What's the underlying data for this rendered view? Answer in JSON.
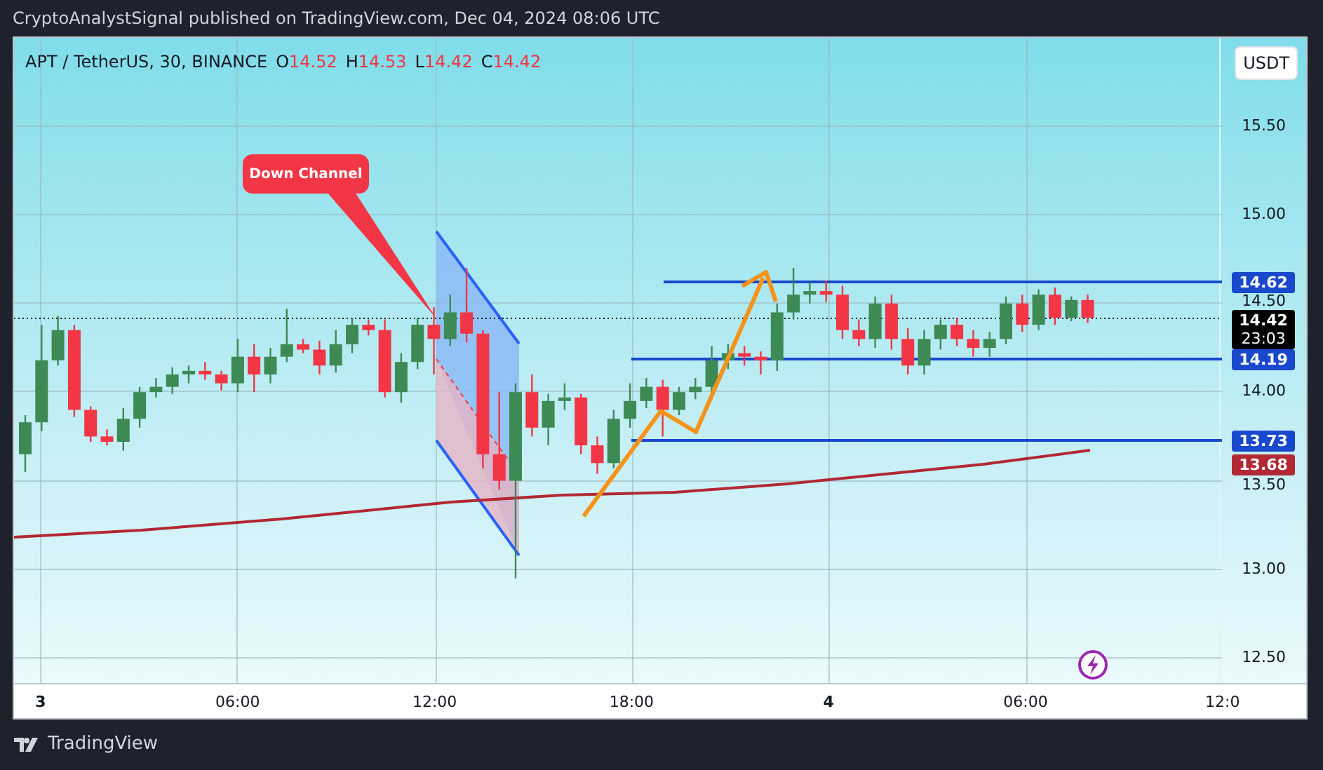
{
  "header": {
    "text": "CryptoAnalystSignal published on TradingView.com, Dec 04, 2024 08:06 UTC"
  },
  "legend": {
    "symbol": "APT / TetherUS, 30, BINANCE",
    "ohlc": [
      {
        "label": "O",
        "value": "14.52"
      },
      {
        "label": "H",
        "value": "14.53"
      },
      {
        "label": "L",
        "value": "14.42"
      },
      {
        "label": "C",
        "value": "14.42"
      }
    ]
  },
  "currency_button": "USDT",
  "annotation": {
    "text": "Down Channel"
  },
  "price_axis": {
    "labels": [
      "15.50",
      "15.00",
      "14.50",
      "14.00",
      "13.50",
      "13.00",
      "12.50"
    ]
  },
  "price_tags": [
    {
      "value": "14.62",
      "color": "#1848cc"
    },
    {
      "value": "14.42",
      "countdown": "23:03",
      "color": "#000000"
    },
    {
      "value": "14.19",
      "color": "#1848cc"
    },
    {
      "value": "13.73",
      "color": "#1848cc"
    },
    {
      "value": "13.68",
      "color": "#b22833"
    }
  ],
  "time_axis": {
    "labels": [
      {
        "text": "3",
        "kind": "day"
      },
      {
        "text": "06:00",
        "kind": "time"
      },
      {
        "text": "12:00",
        "kind": "time"
      },
      {
        "text": "18:00",
        "kind": "time"
      },
      {
        "text": "4",
        "kind": "day"
      },
      {
        "text": "06:00",
        "kind": "time"
      },
      {
        "text": "12:0",
        "kind": "time"
      }
    ]
  },
  "footer": {
    "brand": "TradingView"
  }
}
